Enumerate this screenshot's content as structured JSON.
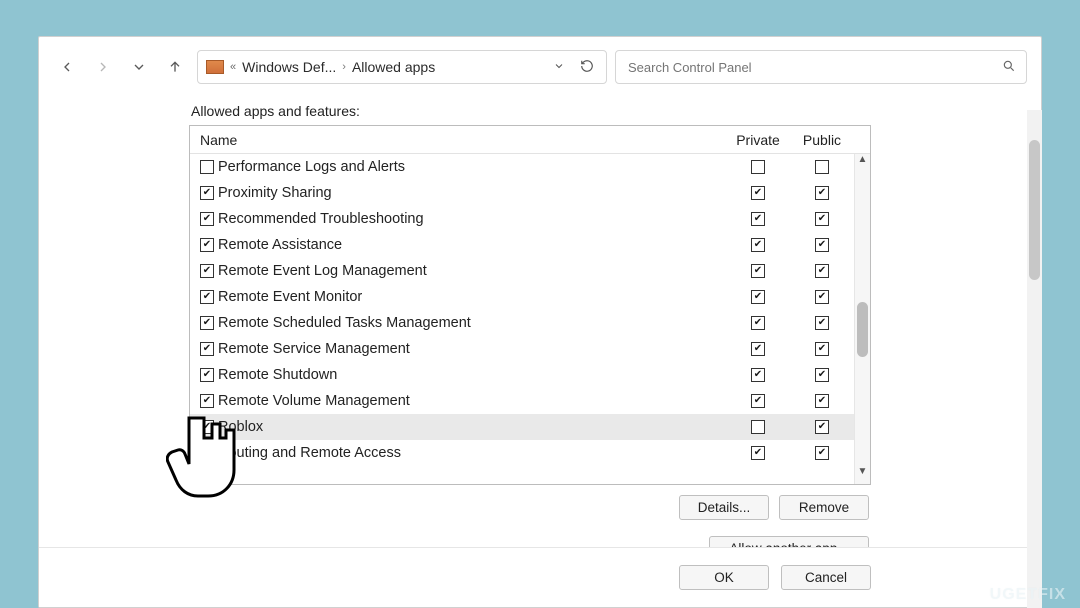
{
  "toolbar": {
    "crumb1": "Windows Def...",
    "crumb2": "Allowed apps",
    "search_placeholder": "Search Control Panel"
  },
  "section_label": "Allowed apps and features:",
  "columns": {
    "name": "Name",
    "private": "Private",
    "public": "Public"
  },
  "rows": [
    {
      "checked": false,
      "name": "Performance Logs and Alerts",
      "private": false,
      "public": false,
      "selected": false
    },
    {
      "checked": true,
      "name": "Proximity Sharing",
      "private": true,
      "public": true,
      "selected": false
    },
    {
      "checked": true,
      "name": "Recommended Troubleshooting",
      "private": true,
      "public": true,
      "selected": false
    },
    {
      "checked": true,
      "name": "Remote Assistance",
      "private": true,
      "public": true,
      "selected": false
    },
    {
      "checked": true,
      "name": "Remote Event Log Management",
      "private": true,
      "public": true,
      "selected": false
    },
    {
      "checked": true,
      "name": "Remote Event Monitor",
      "private": true,
      "public": true,
      "selected": false
    },
    {
      "checked": true,
      "name": "Remote Scheduled Tasks Management",
      "private": true,
      "public": true,
      "selected": false
    },
    {
      "checked": true,
      "name": "Remote Service Management",
      "private": true,
      "public": true,
      "selected": false
    },
    {
      "checked": true,
      "name": "Remote Shutdown",
      "private": true,
      "public": true,
      "selected": false
    },
    {
      "checked": true,
      "name": "Remote Volume Management",
      "private": true,
      "public": true,
      "selected": false
    },
    {
      "checked": true,
      "name": "Roblox",
      "private": false,
      "public": true,
      "selected": true
    },
    {
      "checked": true,
      "name": "Routing and Remote Access",
      "private": true,
      "public": true,
      "selected": false
    }
  ],
  "buttons": {
    "details": "Details...",
    "remove": "Remove",
    "allow_another": "Allow another app...",
    "ok": "OK",
    "cancel": "Cancel"
  },
  "watermark": "UGETFIX"
}
